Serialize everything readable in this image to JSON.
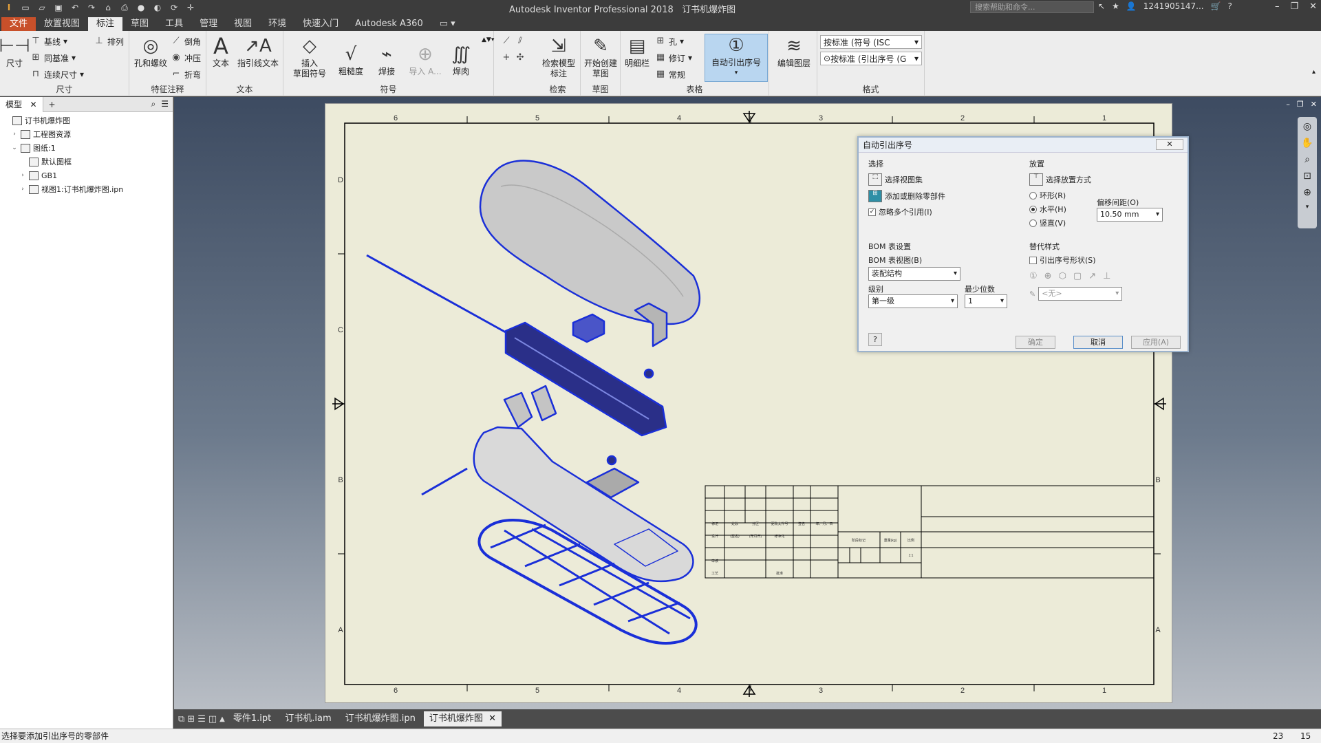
{
  "app_title": "Autodesk Inventor Professional 2018",
  "doc_title": "订书机爆炸图",
  "search_placeholder": "搜索帮助和命令...",
  "user": "1241905147...",
  "tabs": [
    "文件",
    "放置视图",
    "标注",
    "草图",
    "工具",
    "管理",
    "视图",
    "环境",
    "快速入门",
    "Autodesk A360"
  ],
  "ribbon": {
    "dim_panel": {
      "title": "尺寸",
      "big": "尺寸",
      "items": [
        "基线",
        "同基准",
        "连续尺寸"
      ],
      "arrange": "排列"
    },
    "feature_panel": {
      "title": "特征注释",
      "big": "孔和螺纹",
      "items": [
        "倒角",
        "冲压",
        "折弯"
      ]
    },
    "text_panel": {
      "title": "文本",
      "big1": "文本",
      "big2": "指引线文本"
    },
    "symbol_panel": {
      "title": "符号",
      "insert": "插入\n草图符号",
      "items": [
        "粗糙度",
        "焊接",
        "导入 A...",
        "焊肉"
      ]
    },
    "check_panel": {
      "title": "检索",
      "big": "检索模型\n标注"
    },
    "sketch_panel": {
      "title": "草图",
      "big": "开始创建\n草图"
    },
    "table_panel": {
      "title": "表格",
      "mingxi": "明细栏",
      "items": [
        "孔",
        "修订",
        "常规"
      ],
      "balloon": "自动引出序号"
    },
    "layer_panel": {
      "big": "编辑图层"
    },
    "format_panel": {
      "title": "格式",
      "dd1": "按标准 (符号 (ISC",
      "dd2": "按标准 (引出序号 (G"
    }
  },
  "browser": {
    "tab": "模型",
    "tree": [
      {
        "label": "订书机爆炸图",
        "indent": 0,
        "toggle": ""
      },
      {
        "label": "工程图资源",
        "indent": 1,
        "toggle": "›"
      },
      {
        "label": "图纸:1",
        "indent": 1,
        "toggle": "⌄"
      },
      {
        "label": "默认图框",
        "indent": 2,
        "toggle": ""
      },
      {
        "label": "GB1",
        "indent": 2,
        "toggle": "›"
      },
      {
        "label": "视图1:订书机爆炸图.ipn",
        "indent": 2,
        "toggle": "›"
      }
    ]
  },
  "sheet": {
    "top_zones": [
      "6",
      "5",
      "4",
      "3",
      "2",
      "1"
    ],
    "bottom_zones": [
      "6",
      "5",
      "4",
      "3",
      "2",
      "1"
    ],
    "side_zones": [
      "D",
      "C",
      "B",
      "A"
    ],
    "title_block": {
      "c1": "标记",
      "c2": "处数",
      "c3": "分区",
      "c4": "更改文件号",
      "c5": "签名",
      "c6": "年、月、日",
      "d1": "设计",
      "d2": "(签名)",
      "d3": "(年月日)",
      "d4": "标准化",
      "d5": "审核",
      "d6": "工艺",
      "d7": "批准",
      "s1": "阶段标记",
      "s2": "重量(kg)",
      "s3": "比例",
      "s4": "1:1"
    }
  },
  "dialog": {
    "title": "自动引出序号",
    "select_group": "选择",
    "select_view": "选择视图集",
    "add_remove": "添加或删除零部件",
    "ignore_multi": "忽略多个引用(I)",
    "place_group": "放置",
    "select_place": "选择放置方式",
    "ring": "环形(R)",
    "horizontal": "水平(H)",
    "vertical": "竖直(V)",
    "offset_label": "偏移间距(O)",
    "offset_value": "10.50 mm",
    "bom_group": "BOM 表设置",
    "bom_view": "BOM 表视图(B)",
    "bom_view_value": "装配结构",
    "level": "级别",
    "level_value": "第一级",
    "min_digits": "最少位数",
    "min_digits_value": "1",
    "override_group": "替代样式",
    "balloon_shape": "引出序号形状(S)",
    "none_value": "<无>",
    "ok": "确定",
    "cancel": "取消",
    "apply": "应用(A)"
  },
  "doc_tabs": [
    "零件1.ipt",
    "订书机.iam",
    "订书机爆炸图.ipn",
    "订书机爆炸图"
  ],
  "status_text": "选择要添加引出序号的零部件",
  "status_nums": [
    "23",
    "15"
  ]
}
